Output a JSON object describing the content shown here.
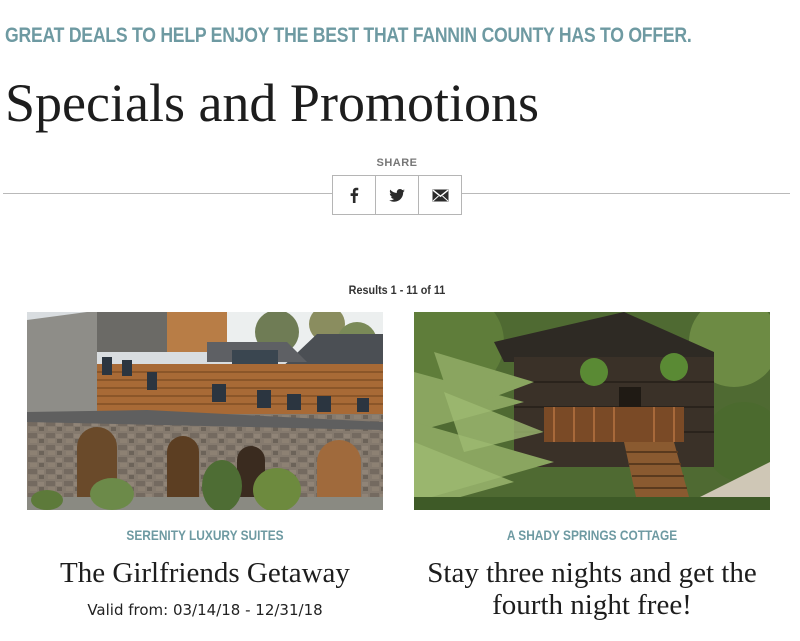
{
  "header": {
    "tagline": "GREAT DEALS TO HELP ENJOY THE BEST THAT FANNIN COUNTY HAS TO OFFER.",
    "title": "Specials and Promotions"
  },
  "share": {
    "label": "SHARE",
    "buttons": [
      {
        "icon": "facebook-icon"
      },
      {
        "icon": "twitter-icon"
      },
      {
        "icon": "email-icon"
      }
    ]
  },
  "results": {
    "text": "Results 1 - 11 of 11"
  },
  "cards": [
    {
      "company": "SERENITY LUXURY SUITES",
      "title": "The Girlfriends Getaway",
      "valid": "Valid from: 03/14/18 - 12/31/18",
      "image": "log-and-stone-lodge-photo"
    },
    {
      "company": "A SHADY SPRINGS COTTAGE",
      "title": "Stay three nights and get the fourth night free!",
      "image": "wooded-cabin-photo"
    }
  ],
  "colors": {
    "accent": "#6e9aa2",
    "title": "#1d1d1d",
    "divider": "#b9b9b9"
  }
}
